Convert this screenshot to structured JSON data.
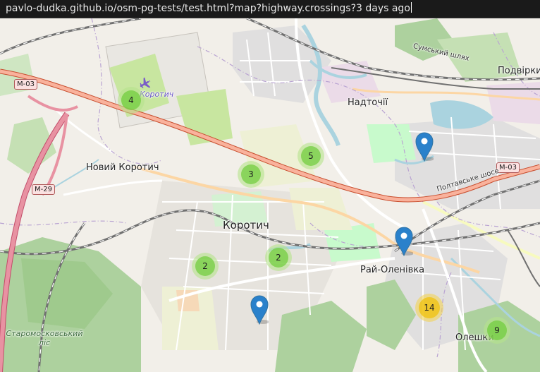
{
  "url_bar": {
    "text": "pavlo-dudka.github.io/osm-pg-tests/test.html?map?highway.crossings?3 days ago"
  },
  "map": {
    "place_labels": [
      {
        "name": "Надточії"
      },
      {
        "name": "Подвірки"
      },
      {
        "name": "Новий Коротич"
      },
      {
        "name": "Коротич"
      },
      {
        "name": "Рай-Оленівка"
      },
      {
        "name": "Олешки"
      },
      {
        "name": "Коротич"
      }
    ],
    "forest_label": {
      "line1": "Старомосковський",
      "line2": "ліс"
    },
    "road_labels": [
      {
        "name": "Сумський шлях"
      },
      {
        "name": "Полтавське шосе"
      }
    ],
    "shields": [
      "М-03",
      "М-03",
      "М-29"
    ],
    "clusters": [
      {
        "count": "4",
        "size": "small"
      },
      {
        "count": "5",
        "size": "small"
      },
      {
        "count": "3",
        "size": "small"
      },
      {
        "count": "2",
        "size": "small"
      },
      {
        "count": "2",
        "size": "small"
      },
      {
        "count": "14",
        "size": "medium"
      },
      {
        "count": "9",
        "size": "small"
      }
    ],
    "markers": 3,
    "colors": {
      "background": "#f2efe9",
      "forest": "#add19e",
      "park": "#c8facc",
      "water": "#aad3df",
      "trunk_road": "#f9b29c",
      "motorway": "#e892a2",
      "rail": "#707070",
      "marker": "#2a81cb"
    }
  }
}
